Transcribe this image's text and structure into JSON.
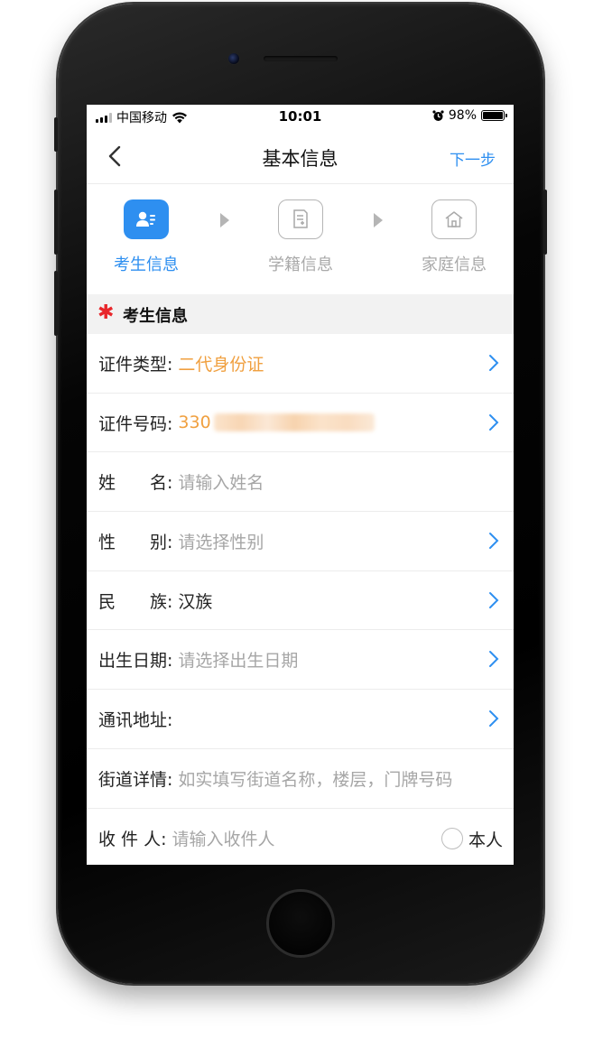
{
  "status_bar": {
    "carrier": "中国移动",
    "time": "10:01",
    "battery": "98%",
    "battery_level": 0.98
  },
  "nav": {
    "title": "基本信息",
    "next_label": "下一步"
  },
  "steps": [
    {
      "label": "考生信息",
      "icon": "student-card-icon",
      "active": true
    },
    {
      "label": "学籍信息",
      "icon": "document-add-icon",
      "active": false
    },
    {
      "label": "家庭信息",
      "icon": "home-icon",
      "active": false
    }
  ],
  "section": {
    "title": "考生信息"
  },
  "form": {
    "id_type": {
      "label": "证件类型:",
      "value": "二代身份证"
    },
    "id_number": {
      "label": "证件号码:",
      "value": "330"
    },
    "name": {
      "label": "姓　　名:",
      "placeholder": "请输入姓名"
    },
    "gender": {
      "label": "性　　别:",
      "placeholder": "请选择性别"
    },
    "ethnicity": {
      "label": "民　　族:",
      "value": "汉族"
    },
    "birthdate": {
      "label": "出生日期:",
      "placeholder": "请选择出生日期"
    },
    "address": {
      "label": "通讯地址:"
    },
    "street": {
      "label": "街道详情:",
      "placeholder": "如实填写街道名称，楼层，门牌号码"
    },
    "recipient": {
      "label": "收 件 人:",
      "placeholder": "请输入收件人",
      "self_label": "本人"
    }
  },
  "colors": {
    "accent": "#2e8ff0",
    "value_orange": "#f0a040",
    "required_red": "#e8262b"
  }
}
